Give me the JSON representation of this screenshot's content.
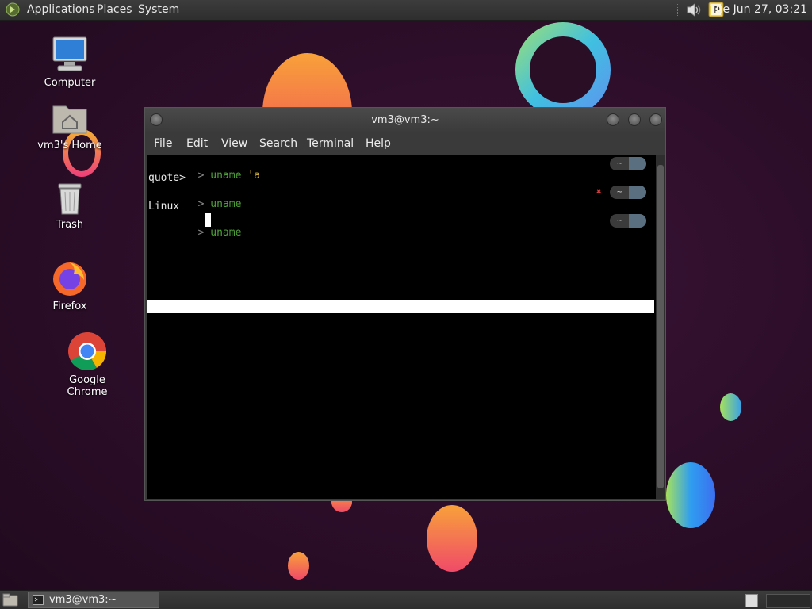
{
  "top_panel": {
    "menus": [
      "Applications",
      "Places",
      "System"
    ],
    "clock": "Tue Jun 27, 03:21",
    "icons": [
      "applications-logo-icon",
      "volume-icon",
      "package-manager-icon"
    ]
  },
  "desktop": {
    "icons": [
      {
        "label": "Computer",
        "icon": "computer-icon"
      },
      {
        "label": "vm3's Home",
        "icon": "home-folder-icon"
      },
      {
        "label": "Trash",
        "icon": "trash-icon"
      },
      {
        "label": "Firefox",
        "icon": "firefox-icon"
      },
      {
        "label": "Google Chrome",
        "icon": "chrome-icon"
      }
    ]
  },
  "terminal": {
    "title": "vm3@vm3:~",
    "menu": [
      "File",
      "Edit",
      "View",
      "Search",
      "Terminal",
      "Help"
    ],
    "lines": [
      {
        "chevron": ">",
        "cmd": "uname",
        "arg": "'a"
      },
      {
        "output": "quote>"
      },
      {
        "chevron": ">",
        "cmd": "uname",
        "arg": ""
      },
      {
        "output": "Linux"
      },
      {
        "chevron": ">",
        "cmd": "uname",
        "arg": ""
      }
    ],
    "prompt_tag": "~",
    "error_mark": "✖",
    "colors": {
      "command": "#4fa33a",
      "argument": "#c8a838",
      "error": "#d13b3b"
    }
  },
  "bottom_panel": {
    "task": "vm3@vm3:~"
  }
}
